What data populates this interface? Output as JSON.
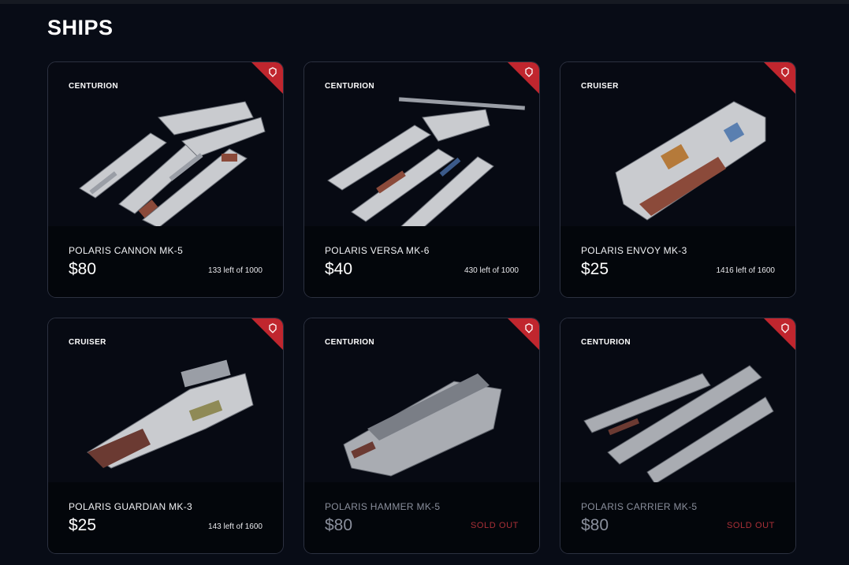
{
  "page": {
    "title": "SHIPS"
  },
  "colors": {
    "accent": "#c0262e",
    "sold_out": "#a93037",
    "card_border": "#2c3140",
    "background": "#080c16"
  },
  "ships": [
    {
      "category": "CENTURION",
      "name": "POLARIS CANNON MK-5",
      "price": "$80",
      "stock": "133 left of 1000",
      "sold_out": false,
      "icon": "faction-emblem-icon"
    },
    {
      "category": "CENTURION",
      "name": "POLARIS VERSA MK-6",
      "price": "$40",
      "stock": "430 left of 1000",
      "sold_out": false,
      "icon": "faction-emblem-icon"
    },
    {
      "category": "CRUISER",
      "name": "POLARIS ENVOY MK-3",
      "price": "$25",
      "stock": "1416 left of 1600",
      "sold_out": false,
      "icon": "faction-emblem-icon"
    },
    {
      "category": "CRUISER",
      "name": "POLARIS GUARDIAN MK-3",
      "price": "$25",
      "stock": "143 left of 1600",
      "sold_out": false,
      "icon": "faction-emblem-icon"
    },
    {
      "category": "CENTURION",
      "name": "POLARIS HAMMER MK-5",
      "price": "$80",
      "stock": "SOLD OUT",
      "sold_out": true,
      "icon": "faction-emblem-icon"
    },
    {
      "category": "CENTURION",
      "name": "POLARIS CARRIER MK-5",
      "price": "$80",
      "stock": "SOLD OUT",
      "sold_out": true,
      "icon": "faction-emblem-icon"
    }
  ]
}
